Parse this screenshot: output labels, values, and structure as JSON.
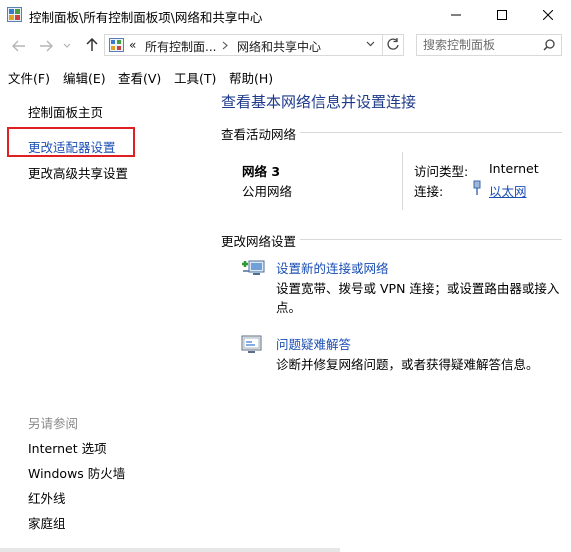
{
  "window": {
    "title": "控制面板\\所有控制面板项\\网络和共享中心"
  },
  "address": {
    "overflow": "«",
    "crumbs": [
      "所有控制面...",
      "网络和共享中心"
    ]
  },
  "search": {
    "placeholder": "搜索控制面板"
  },
  "menu": {
    "items": [
      "文件(F)",
      "编辑(E)",
      "查看(V)",
      "工具(T)",
      "帮助(H)"
    ]
  },
  "sidebar": {
    "home": "控制面板主页",
    "change_adapter": "更改适配器设置",
    "advanced_sharing": "更改高级共享设置",
    "see_also_title": "另请参阅",
    "see_also": [
      "Internet 选项",
      "Windows 防火墙",
      "红外线",
      "家庭组"
    ]
  },
  "main": {
    "heading": "查看基本网络信息并设置连接",
    "active_networks_label": "查看活动网络",
    "network": {
      "name": "网络  3",
      "type": "公用网络",
      "access_type_label": "访问类型:",
      "access_type_value": "Internet",
      "connections_label": "连接:",
      "connections_value": "以太网"
    },
    "change_settings_label": "更改网络设置",
    "tasks": [
      {
        "link": "设置新的连接或网络",
        "desc": "设置宽带、拨号或 VPN 连接；或设置路由器或接入点。"
      },
      {
        "link": "问题疑难解答",
        "desc": "诊断并修复网络问题，或者获得疑难解答信息。"
      }
    ]
  },
  "colors": {
    "link": "#1a4eb4",
    "heading": "#1e3a8a",
    "highlight": "#e02020"
  }
}
